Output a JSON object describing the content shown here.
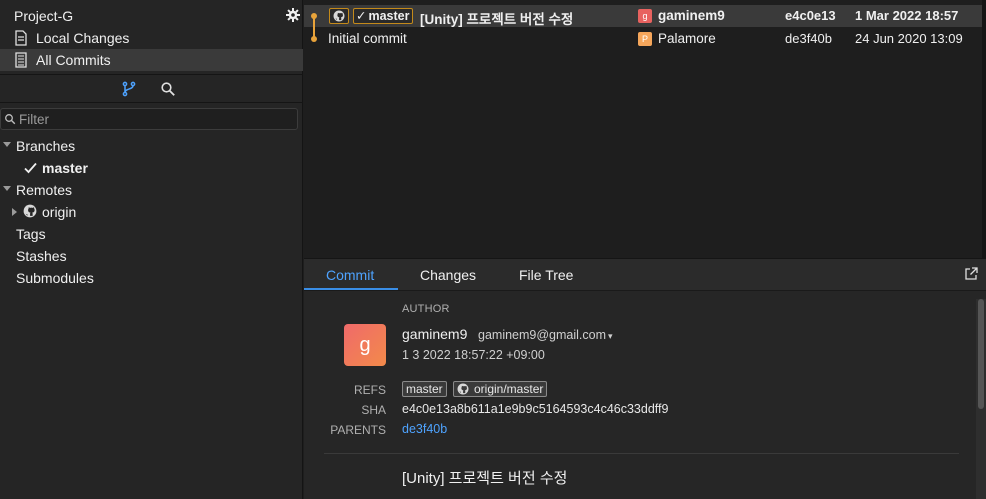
{
  "sidebar": {
    "project_name": "Project-G",
    "nav": [
      {
        "label": "Local Changes",
        "icon": "document-icon"
      },
      {
        "label": "All Commits",
        "icon": "commit-list-icon"
      }
    ],
    "filter_placeholder": "Filter",
    "branches_header": "Branches",
    "current_branch": "master",
    "remotes_header": "Remotes",
    "remote_name": "origin",
    "tags_header": "Tags",
    "stashes_header": "Stashes",
    "submodules_header": "Submodules"
  },
  "commits": [
    {
      "ref_label": "master",
      "message": "[Unity] 프로젝트 버전 수정",
      "avatar_letter": "g",
      "avatar_color": "#e8625f",
      "author": "gaminem9",
      "sha": "e4c0e13",
      "date": "1 Mar 2022 18:57"
    },
    {
      "message": "Initial commit",
      "avatar_letter": "P",
      "avatar_color": "#f5a65b",
      "author": "Palamore",
      "sha": "de3f40b",
      "date": "24 Jun 2020 13:09"
    }
  ],
  "details": {
    "tabs": [
      "Commit",
      "Changes",
      "File Tree"
    ],
    "author_label": "AUTHOR",
    "avatar_letter": "g",
    "author_name": "gaminem9",
    "author_email": "gaminem9@gmail.com",
    "author_date": "1 3 2022 18:57:22 +09:00",
    "refs_label": "REFS",
    "refs": [
      "master",
      "origin/master"
    ],
    "sha_label": "SHA",
    "sha_full": "e4c0e13a8b611a1e9b9c5164593c4c46c33ddff9",
    "parents_label": "PARENTS",
    "parent": "de3f40b",
    "summary": "[Unity] 프로젝트 버전 수정"
  },
  "colors": {
    "accent": "#4ea3ff",
    "graph_line": "#e8a33a",
    "ref_border": "#c48a1a"
  }
}
